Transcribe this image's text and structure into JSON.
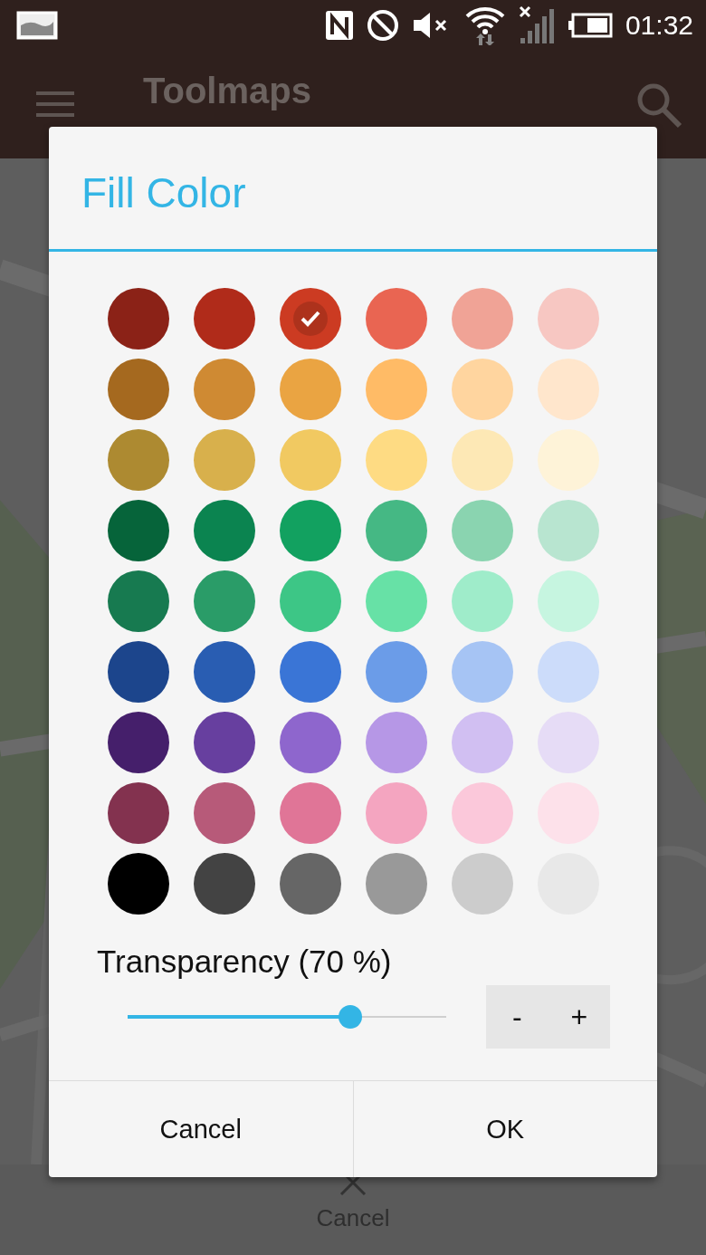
{
  "status_bar": {
    "time": "01:32"
  },
  "app_bar": {
    "title": "Toolmaps"
  },
  "dialog": {
    "title": "Fill Color",
    "swatches": [
      {
        "color": "#8b2217",
        "selected": false
      },
      {
        "color": "#b02b1a",
        "selected": false
      },
      {
        "color": "#cc3b22",
        "selected": true
      },
      {
        "color": "#e96552",
        "selected": false
      },
      {
        "color": "#f0a396",
        "selected": false
      },
      {
        "color": "#f7c7c2",
        "selected": false
      },
      {
        "color": "#a5691f",
        "selected": false
      },
      {
        "color": "#cf8a33",
        "selected": false
      },
      {
        "color": "#eaa442",
        "selected": false
      },
      {
        "color": "#ffbb66",
        "selected": false
      },
      {
        "color": "#ffd59f",
        "selected": false
      },
      {
        "color": "#ffe6cc",
        "selected": false
      },
      {
        "color": "#ad8a31",
        "selected": false
      },
      {
        "color": "#d8b04c",
        "selected": false
      },
      {
        "color": "#f1c961",
        "selected": false
      },
      {
        "color": "#fedb83",
        "selected": false
      },
      {
        "color": "#fde8b5",
        "selected": false
      },
      {
        "color": "#fef3d8",
        "selected": false
      },
      {
        "color": "#06643a",
        "selected": false
      },
      {
        "color": "#0b8450",
        "selected": false
      },
      {
        "color": "#12a160",
        "selected": false
      },
      {
        "color": "#45b884",
        "selected": false
      },
      {
        "color": "#8ad4b0",
        "selected": false
      },
      {
        "color": "#b8e5d0",
        "selected": false
      },
      {
        "color": "#177a50",
        "selected": false
      },
      {
        "color": "#2a9c68",
        "selected": false
      },
      {
        "color": "#3dc686",
        "selected": false
      },
      {
        "color": "#67e1a6",
        "selected": false
      },
      {
        "color": "#9fecca",
        "selected": false
      },
      {
        "color": "#c6f5e0",
        "selected": false
      },
      {
        "color": "#1c458c",
        "selected": false
      },
      {
        "color": "#295db2",
        "selected": false
      },
      {
        "color": "#3a75d6",
        "selected": false
      },
      {
        "color": "#6b9ce8",
        "selected": false
      },
      {
        "color": "#a6c4f4",
        "selected": false
      },
      {
        "color": "#ccdcfa",
        "selected": false
      },
      {
        "color": "#451f6b",
        "selected": false
      },
      {
        "color": "#673f9f",
        "selected": false
      },
      {
        "color": "#8e66cd",
        "selected": false
      },
      {
        "color": "#b697e6",
        "selected": false
      },
      {
        "color": "#d1bff2",
        "selected": false
      },
      {
        "color": "#e6dcf6",
        "selected": false
      },
      {
        "color": "#83324f",
        "selected": false
      },
      {
        "color": "#b75a79",
        "selected": false
      },
      {
        "color": "#e07597",
        "selected": false
      },
      {
        "color": "#f4a5c0",
        "selected": false
      },
      {
        "color": "#fbc8da",
        "selected": false
      },
      {
        "color": "#fde1ea",
        "selected": false
      },
      {
        "color": "#000000",
        "selected": false
      },
      {
        "color": "#434343",
        "selected": false
      },
      {
        "color": "#666666",
        "selected": false
      },
      {
        "color": "#999999",
        "selected": false
      },
      {
        "color": "#cccccc",
        "selected": false
      },
      {
        "color": "#e8e8e8",
        "selected": false
      }
    ],
    "transparency": {
      "label": "Transparency (70 %)",
      "level": 0.7
    },
    "stepper": [
      "-",
      "+"
    ],
    "buttons": [
      "Cancel",
      "OK"
    ]
  },
  "bottom_action": {
    "label": "Cancel"
  }
}
